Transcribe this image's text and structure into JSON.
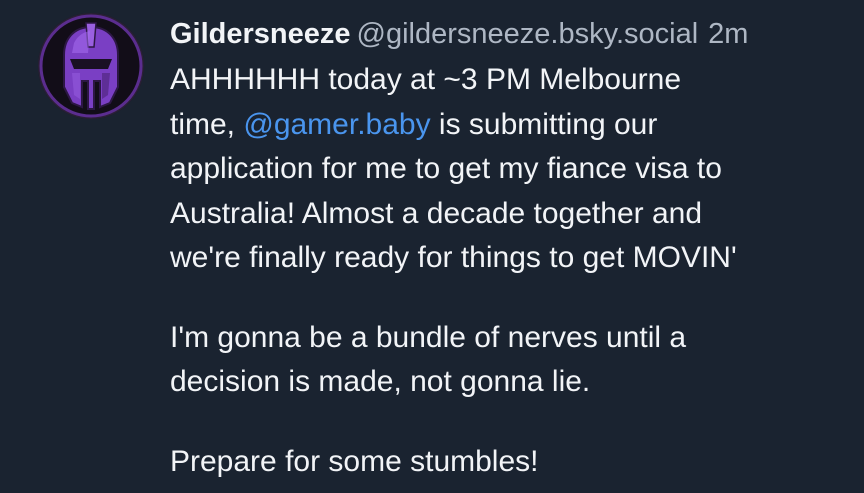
{
  "post": {
    "author": {
      "display_name": "Gildersneeze",
      "handle": "@gildersneeze.bsky.social",
      "avatar_icon": "purple-knight-helmet-icon"
    },
    "timestamp": "2m",
    "text": {
      "p1": {
        "l1": "AHHHHHH today at ~3 PM Melbourne",
        "l2_before": "time, ",
        "l2_mention": "@gamer.baby",
        "l2_after": " is submitting our",
        "l3": "application for me to get my fiance visa to",
        "l4": "Australia! Almost a decade together and",
        "l5": "we're finally ready for things to get MOVIN'"
      },
      "p2": {
        "l1": "I'm gonna be a bundle of nerves until a",
        "l2": "decision is made, not gonna lie."
      },
      "p3": {
        "l1": "Prepare for some stumbles!"
      }
    }
  },
  "colors": {
    "background": "#1a2330",
    "text": "#f2f4f7",
    "muted": "#aeb7c4",
    "mention": "#4a95ee",
    "avatar_accent": "#7a3fc4"
  }
}
